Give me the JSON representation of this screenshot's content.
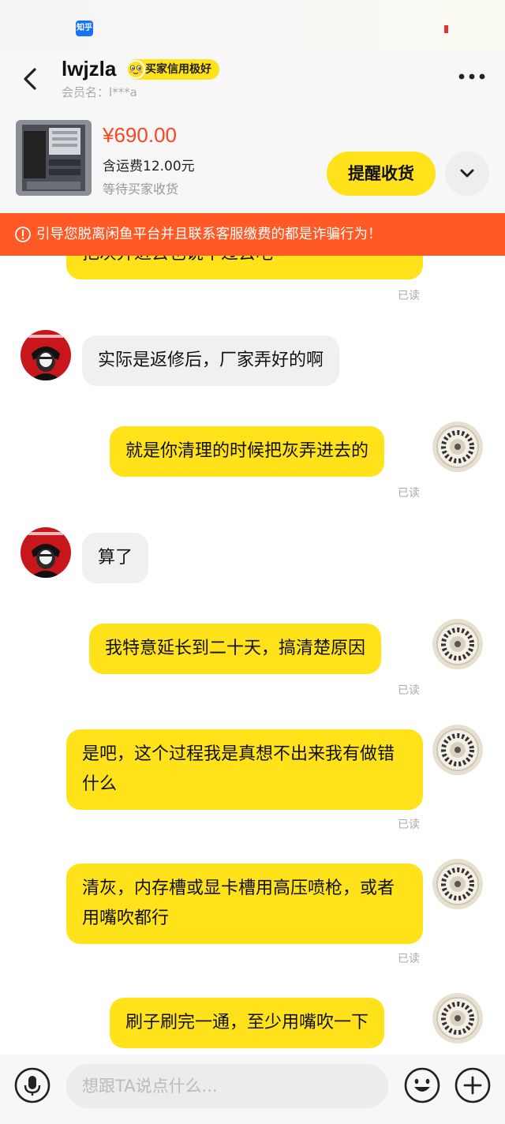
{
  "status_bar": {
    "app_icon_label": "知乎"
  },
  "header": {
    "username": "lwjzla",
    "credit_badge": "买家信用极好",
    "member_name": "会员名：l***a"
  },
  "product": {
    "price": "¥690.00",
    "shipping": "含运费12.00元",
    "status": "等待买家收货",
    "remind_button": "提醒收货"
  },
  "warning": {
    "text": "引导您脱离闲鱼平台并且联系客服缴费的都是诈骗行为！"
  },
  "messages": [
    {
      "side": "me",
      "text": "把灰弄进去也说不过去吧",
      "read": "已读"
    },
    {
      "side": "them",
      "text": "实际是返修后，厂家弄好的啊"
    },
    {
      "side": "me",
      "text": "就是你清理的时候把灰弄进去的",
      "read": "已读"
    },
    {
      "side": "them",
      "text": "算了"
    },
    {
      "side": "me",
      "text": "我特意延长到二十天，搞清楚原因",
      "read": "已读"
    },
    {
      "side": "me",
      "text": "是吧，这个过程我是真想不出来我有做错什么",
      "read": "已读"
    },
    {
      "side": "me",
      "text": "清灰，内存槽或显卡槽用高压喷枪，或者用嘴吹都行",
      "read": "已读"
    },
    {
      "side": "me",
      "text": "刷子刷完一通，至少用嘴吹一下"
    }
  ],
  "input": {
    "placeholder": "想跟TA说点什么..."
  },
  "colors": {
    "accent": "#ffe21a",
    "warning": "#ff5a26",
    "price": "#ff4422"
  }
}
